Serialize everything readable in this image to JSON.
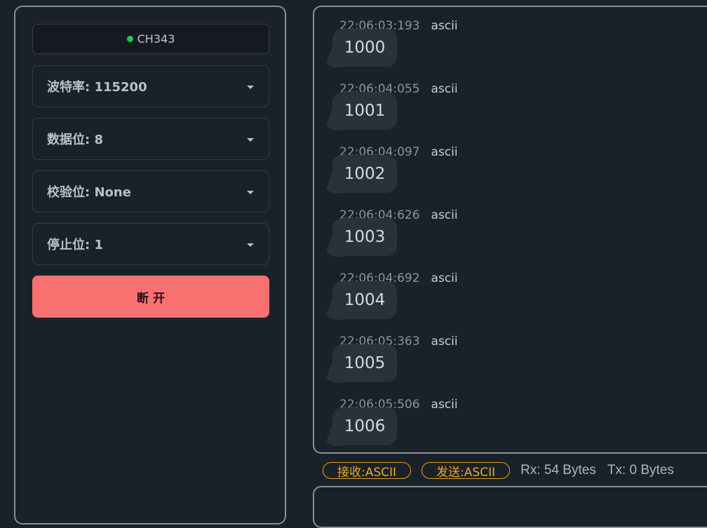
{
  "connection": {
    "port_name": "CH343",
    "status_color": "#22c55e"
  },
  "settings": {
    "baud_rate": "波特率: 115200",
    "data_bits": "数据位: 8",
    "parity": "校验位: None",
    "stop_bits": "停止位: 1"
  },
  "actions": {
    "disconnect_label": "断 开",
    "disconnect_color": "#f87171"
  },
  "messages": [
    {
      "time": "22:06:03:193",
      "encoding": "ascii",
      "content": "1000"
    },
    {
      "time": "22:06:04:055",
      "encoding": "ascii",
      "content": "1001"
    },
    {
      "time": "22:06:04:097",
      "encoding": "ascii",
      "content": "1002"
    },
    {
      "time": "22:06:04:626",
      "encoding": "ascii",
      "content": "1003"
    },
    {
      "time": "22:06:04:692",
      "encoding": "ascii",
      "content": "1004"
    },
    {
      "time": "22:06:05:363",
      "encoding": "ascii",
      "content": "1005"
    },
    {
      "time": "22:06:05:506",
      "encoding": "ascii",
      "content": "1006"
    }
  ],
  "status_bar": {
    "rx_mode": "接收:ASCII",
    "tx_mode": "发送:ASCII",
    "rx_count": "Rx: 54 Bytes",
    "tx_count": "Tx: 0 Bytes"
  },
  "icons": {
    "status": "status-dot-icon",
    "dropdown": "chevron-down-icon"
  }
}
